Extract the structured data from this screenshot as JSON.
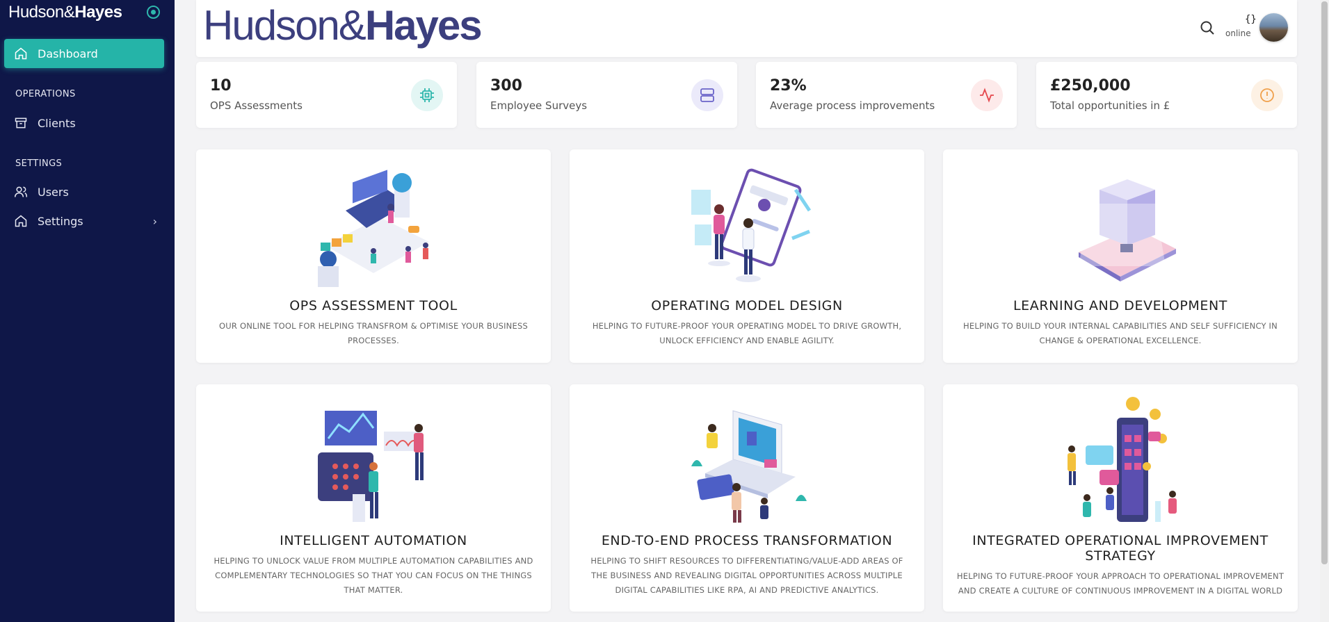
{
  "sidebar": {
    "brand_light": "Hudson&",
    "brand_bold": "Hayes",
    "nav": {
      "dashboard": "Dashboard",
      "section_operations": "OPERATIONS",
      "clients": "Clients",
      "section_settings": "SETTINGS",
      "users": "Users",
      "settings": "Settings"
    }
  },
  "header": {
    "logo_light": "Hudson&",
    "logo_bold": "Hayes",
    "status_brace": "{}",
    "status_text": "online"
  },
  "stats": [
    {
      "value": "10",
      "label": "OPS Assessments",
      "icon": "chip-icon",
      "color": "#2fb7ad",
      "bg": "#e3f6f4"
    },
    {
      "value": "300",
      "label": "Employee Surveys",
      "icon": "server-icon",
      "color": "#6a63c9",
      "bg": "#ebeafa"
    },
    {
      "value": "23%",
      "label": "Average process improvements",
      "icon": "activity-icon",
      "color": "#e5484d",
      "bg": "#fdeaea"
    },
    {
      "value": "£250,000",
      "label": "Total opportunities in £",
      "icon": "alert-circle-icon",
      "color": "#f0a04b",
      "bg": "#fdf1e4"
    }
  ],
  "cards": [
    {
      "title": "OPS ASSESSMENT TOOL",
      "description": "OUR ONLINE TOOL FOR HELPING TRANSFROM & OPTIMISE YOUR BUSINESS PROCESSES."
    },
    {
      "title": "OPERATING MODEL DESIGN",
      "description": "HELPING TO FUTURE-PROOF YOUR OPERATING MODEL TO DRIVE GROWTH, UNLOCK EFFICIENCY AND ENABLE AGILITY."
    },
    {
      "title": "LEARNING AND DEVELOPMENT",
      "description": "HELPING TO BUILD YOUR INTERNAL CAPABILITIES AND SELF SUFFICIENCY IN CHANGE & OPERATIONAL EXCELLENCE."
    },
    {
      "title": "INTELLIGENT AUTOMATION",
      "description": "HELPING TO UNLOCK VALUE FROM MULTIPLE AUTOMATION CAPABILITIES AND COMPLEMENTARY TECHNOLOGIES SO THAT YOU CAN FOCUS ON THE THINGS THAT MATTER."
    },
    {
      "title": "END-TO-END PROCESS TRANSFORMATION",
      "description": "HELPING TO SHIFT RESOURCES TO DIFFERENTIATING/VALUE-ADD AREAS OF THE BUSINESS AND REVEALING DIGITAL OPPORTUNITIES ACROSS MULTIPLE DIGITAL CAPABILITIES LIKE RPA, AI AND PREDICTIVE ANALYTICS."
    },
    {
      "title": "INTEGRATED OPERATIONAL IMPROVEMENT STRATEGY",
      "description": "HELPING TO FUTURE-PROOF YOUR APPROACH TO OPERATIONAL IMPROVEMENT AND CREATE A CULTURE OF CONTINUOUS IMPROVEMENT IN A DIGITAL WORLD"
    }
  ],
  "colors": {
    "sidebar_bg": "#0f1748",
    "accent": "#25b4a8",
    "logo": "#3c3f7e"
  }
}
